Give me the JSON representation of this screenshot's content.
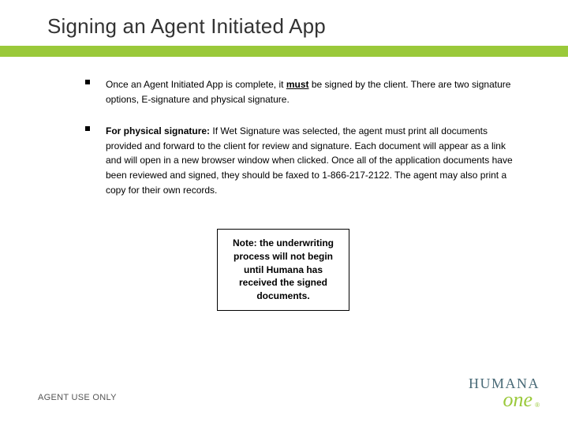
{
  "colors": {
    "accent_green": "#9ac93a",
    "brand_teal": "#4a6b78"
  },
  "title": "Signing an Agent Initiated App",
  "bullets": {
    "b1": {
      "pre": "Once an Agent Initiated App is complete, it ",
      "must": "must",
      "post": " be signed by the client. There are two signature options, E-signature and physical signature."
    },
    "b2": {
      "lead": "For physical signature: ",
      "rest": "If Wet Signature was selected, the agent must print all documents provided and forward to the client for review and signature. Each document will appear as a link and will open in a new browser window when clicked. Once all of the application documents have been reviewed and signed, they should be faxed to 1-866-217-2122. The agent may also print a copy for their own records."
    }
  },
  "note": "Note: the underwriting process will not begin until Humana has received the signed documents.",
  "footer": "AGENT USE ONLY",
  "logo": {
    "brand": "HUMANA",
    "sub": "one",
    "reg": "®"
  }
}
